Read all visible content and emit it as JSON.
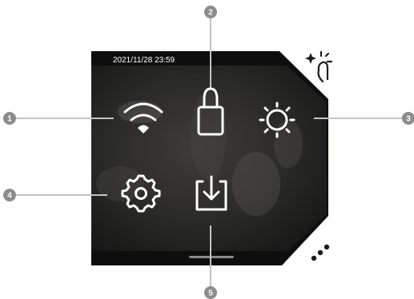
{
  "status_bar": {
    "datetime": "2021/11/28 23:59"
  },
  "icons": [
    {
      "id": 1,
      "name": "wifi-icon"
    },
    {
      "id": 2,
      "name": "lock-icon"
    },
    {
      "id": 3,
      "name": "brightness-icon"
    },
    {
      "id": 4,
      "name": "settings-icon"
    },
    {
      "id": 5,
      "name": "download-icon"
    }
  ],
  "callouts": {
    "c1": "1",
    "c2": "2",
    "c3": "3",
    "c4": "4",
    "c5": "5"
  },
  "decorations": [
    "sparkle-pointer-icon",
    "more-dots-icon"
  ],
  "colors": {
    "callout": "#8c8c8c",
    "leader": "#c4c4c4",
    "screen": "#0e0e0e",
    "icon": "#ffffff"
  }
}
